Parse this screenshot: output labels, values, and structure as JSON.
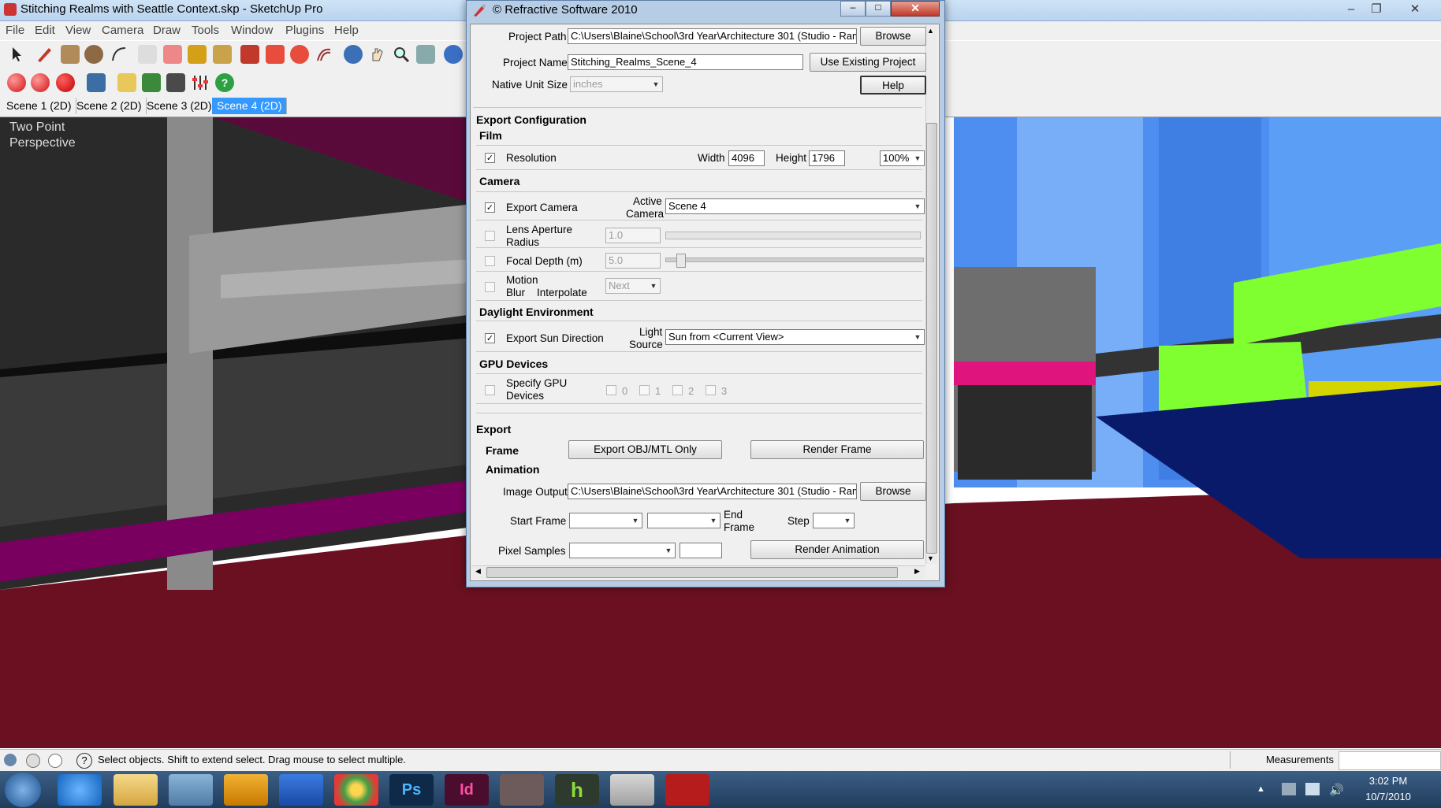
{
  "app": {
    "title": "Stitching Realms with Seattle Context.skp - SketchUp Pro",
    "menus": [
      "File",
      "Edit",
      "View",
      "Camera",
      "Draw",
      "Tools",
      "Window",
      "Plugins",
      "Help"
    ],
    "scene_tabs": [
      "Scene 1 (2D)",
      "Scene 2 (2D)",
      "Scene 3 (2D)",
      "Scene 4 (2D)"
    ],
    "active_scene": "Scene 4 (2D)",
    "viewport_label_line1": "Two Point",
    "viewport_label_line2": "Perspective",
    "status_text": "Select objects. Shift to extend select. Drag mouse to select multiple.",
    "measurements_label": "Measurements",
    "colors": {
      "accent": "#3399ff",
      "ground": "#6b1020",
      "magenta": "#c8007a",
      "train": "#80ff30"
    }
  },
  "dialog": {
    "title": "© Refractive Software 2010",
    "project_path_label": "Project Path",
    "project_path_value": "C:\\Users\\Blaine\\School\\3rd Year\\Architecture 301 (Studio - Raman",
    "browse_label": "Browse",
    "project_name_label": "Project Name",
    "project_name_value": "Stitching_Realms_Scene_4",
    "use_existing_label": "Use Existing Project",
    "native_unit_label": "Native Unit Size",
    "native_unit_value": "inches",
    "help_label": "Help",
    "export_config_header": "Export Configuration",
    "film_header": "Film",
    "resolution_label": "Resolution",
    "width_label": "Width",
    "width_value": "4096",
    "height_label": "Height",
    "height_value": "1796",
    "scale_value": "100%",
    "camera_header": "Camera",
    "export_camera_label": "Export Camera",
    "active_camera_label_1": "Active",
    "active_camera_label_2": "Camera",
    "active_camera_value": "Scene 4",
    "lens_aperture_label_1": "Lens Aperture",
    "lens_aperture_label_2": "Radius",
    "lens_aperture_value": "1.0",
    "focal_depth_label": "Focal Depth (m)",
    "focal_depth_value": "5.0",
    "motion_blur_label_1": "Motion",
    "motion_blur_label_2": "Blur",
    "interpolate_label": "Interpolate",
    "interpolate_value": "Next",
    "daylight_header": "Daylight Environment",
    "export_sun_label": "Export Sun Direction",
    "light_source_label_1": "Light",
    "light_source_label_2": "Source",
    "light_source_value": "Sun from <Current View>",
    "gpu_header": "GPU Devices",
    "specify_gpu_label_1": "Specify GPU",
    "specify_gpu_label_2": "Devices",
    "gpu_options": [
      "0",
      "1",
      "2",
      "3"
    ],
    "export_header": "Export",
    "frame_label": "Frame",
    "export_obj_label": "Export OBJ/MTL Only",
    "render_frame_label": "Render Frame",
    "animation_label": "Animation",
    "image_output_label": "Image Output",
    "image_output_value": "C:\\Users\\Blaine\\School\\3rd Year\\Architecture 301 (Studio - Raman",
    "start_frame_label": "Start Frame",
    "end_frame_label_1": "End",
    "end_frame_label_2": "Frame",
    "step_label": "Step",
    "pixel_samples_label": "Pixel Samples",
    "render_animation_label": "Render Animation",
    "checks": {
      "resolution": true,
      "export_camera": true,
      "lens_aperture": false,
      "focal_depth": false,
      "motion_blur": false,
      "export_sun": true,
      "specify_gpu": false
    }
  },
  "taskbar": {
    "apps": [
      "internet-explorer",
      "file-explorer",
      "remote-desktop",
      "blender",
      "poser",
      "chrome",
      "photoshop",
      "indesign",
      "3d-app",
      "h-app",
      "sketchup",
      "acrobat"
    ],
    "time": "3:02 PM",
    "date": "10/7/2010"
  }
}
